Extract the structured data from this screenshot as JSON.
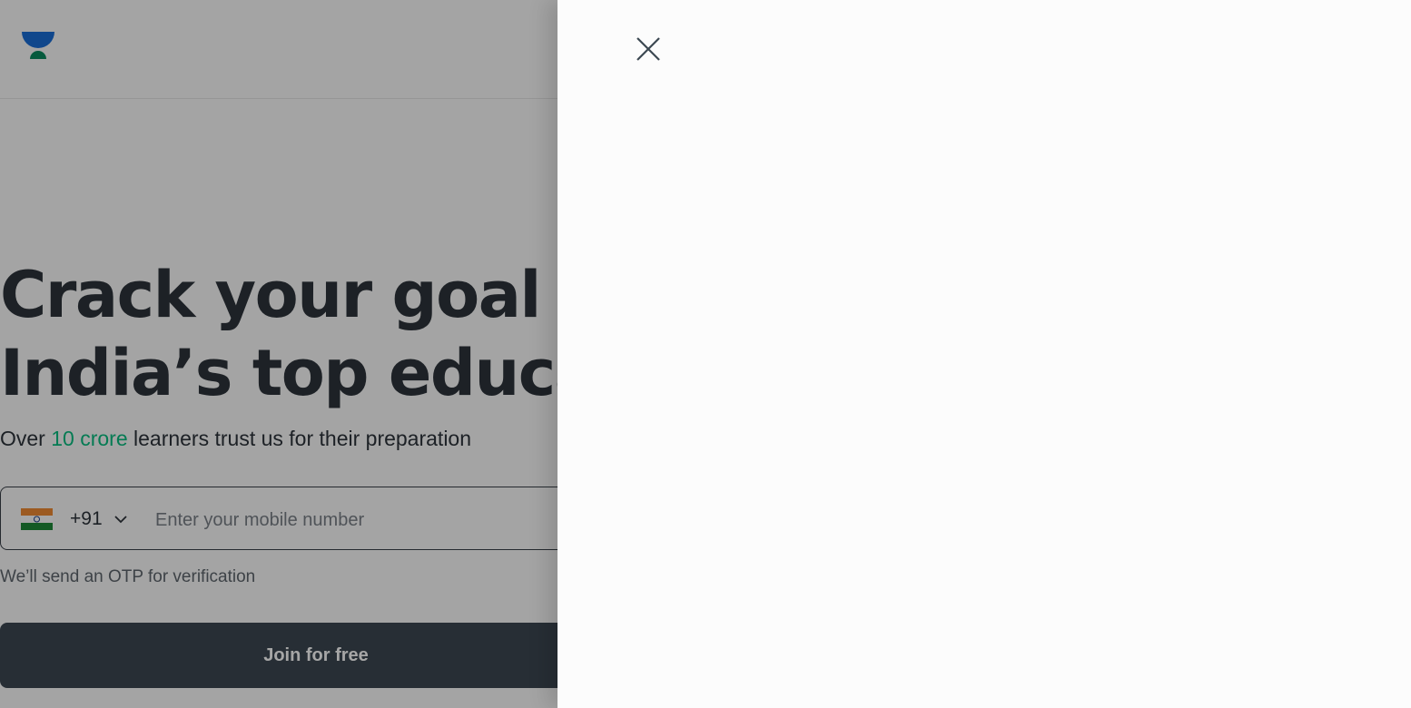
{
  "landing": {
    "logo_icon": "unacademy-logo-icon",
    "headline": {
      "line1": "Crack your goal wi",
      "line2": "India’s top educato"
    },
    "subline": {
      "prefix": "Over ",
      "highlight": "10 crore",
      "suffix": " learners trust us for their preparation"
    },
    "phone": {
      "flag_icon": "india-flag-icon",
      "country_code": "+91",
      "dropdown_icon": "chevron-down-icon",
      "placeholder": "Enter your mobile number",
      "value": ""
    },
    "otp_note": "We’ll send an OTP for verification",
    "join_button": "Join for free"
  },
  "drawer": {
    "close_icon": "close-icon"
  },
  "colors": {
    "accent_green": "#08bd80",
    "text_dark": "#2d343b",
    "button_bg": "#3c4852",
    "logo_blue": "#1a6ed8",
    "logo_green": "#0a8a5f"
  }
}
